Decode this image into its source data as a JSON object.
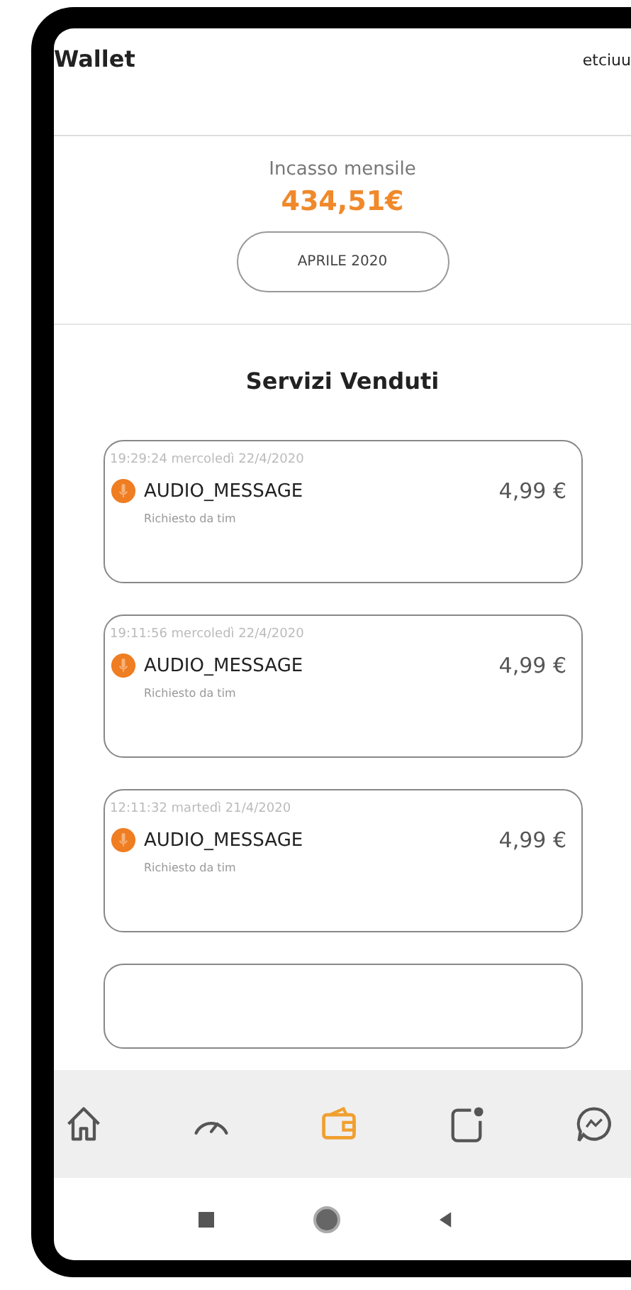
{
  "header": {
    "title": "Wallet",
    "user": "etciuu"
  },
  "summary": {
    "label": "Incasso mensile",
    "amount": "434,51€",
    "month_button": "APRILE 2020"
  },
  "section_title": "Servizi Venduti",
  "sales": [
    {
      "timestamp": "19:29:24  mercoledì 22/4/2020",
      "service": "AUDIO_MESSAGE",
      "price": "4,99 €",
      "requested_by": "Richiesto da tim"
    },
    {
      "timestamp": "19:11:56  mercoledì 22/4/2020",
      "service": "AUDIO_MESSAGE",
      "price": "4,99 €",
      "requested_by": "Richiesto da tim"
    },
    {
      "timestamp": "12:11:32  martedì 21/4/2020",
      "service": "AUDIO_MESSAGE",
      "price": "4,99 €",
      "requested_by": "Richiesto da tim"
    }
  ],
  "bottom_nav": [
    {
      "kind": "home",
      "selected": false
    },
    {
      "kind": "gauge",
      "selected": false
    },
    {
      "kind": "wallet",
      "selected": true
    },
    {
      "kind": "tablet",
      "selected": false
    },
    {
      "kind": "chat",
      "selected": false
    }
  ]
}
